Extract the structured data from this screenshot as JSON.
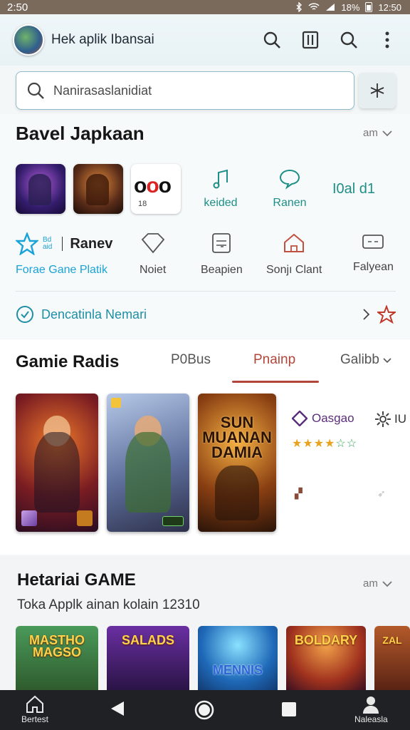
{
  "status_bar": {
    "time": "2:50",
    "battery": "18%",
    "clock": "12:50"
  },
  "app_bar": {
    "title": "Hek aplik Ibansai"
  },
  "search": {
    "placeholder": "Nanirasaslanidiat"
  },
  "section1": {
    "title": "Bavel Japkaan",
    "more": "am",
    "thumb3_num": "18",
    "quick_items": [
      {
        "label": "keided",
        "icon": "music-note-icon"
      },
      {
        "label": "Ranen",
        "icon": "chat-bubble-icon"
      },
      {
        "label": "I0al d1",
        "icon": ""
      }
    ],
    "brand": {
      "small_line1": "Bd",
      "small_line2": "aid",
      "name": "Ranev",
      "label": "Forae Gane Platik"
    },
    "categories": [
      {
        "label": "Noiet",
        "icon": "diamond-icon"
      },
      {
        "label": "Beapien",
        "icon": "document-icon"
      },
      {
        "label": "Sonjı Clant",
        "icon": "house-icon"
      },
      {
        "label": "Falyean",
        "icon": "ticket-icon"
      }
    ],
    "promo": "Dencatinla Nemari"
  },
  "section2": {
    "title": "Gamie Radis",
    "tabs": [
      "P0Bus",
      "Pnainp",
      "Galibb"
    ],
    "active_tab": 1,
    "poster3_title": "SUN MUANAN DAMIA",
    "side": {
      "brand": "Oasgao",
      "rating_stars": "★★★★☆☆",
      "gear_text": "IU"
    }
  },
  "section3": {
    "title": "Hetariai GAME",
    "more": "am",
    "subtitle": "Toka Applk ainan kolain 12310",
    "tiles": [
      "MASTHO MAGSO",
      "SALADS",
      "MENNIS",
      "BOLDARY",
      "ZAL"
    ]
  },
  "nav": {
    "left_label": "Bertest",
    "right_label": "Naleasla"
  },
  "colors": {
    "accent_teal": "#1e8f86",
    "accent_red": "#b2453a",
    "link_blue": "#1aa3d6"
  }
}
